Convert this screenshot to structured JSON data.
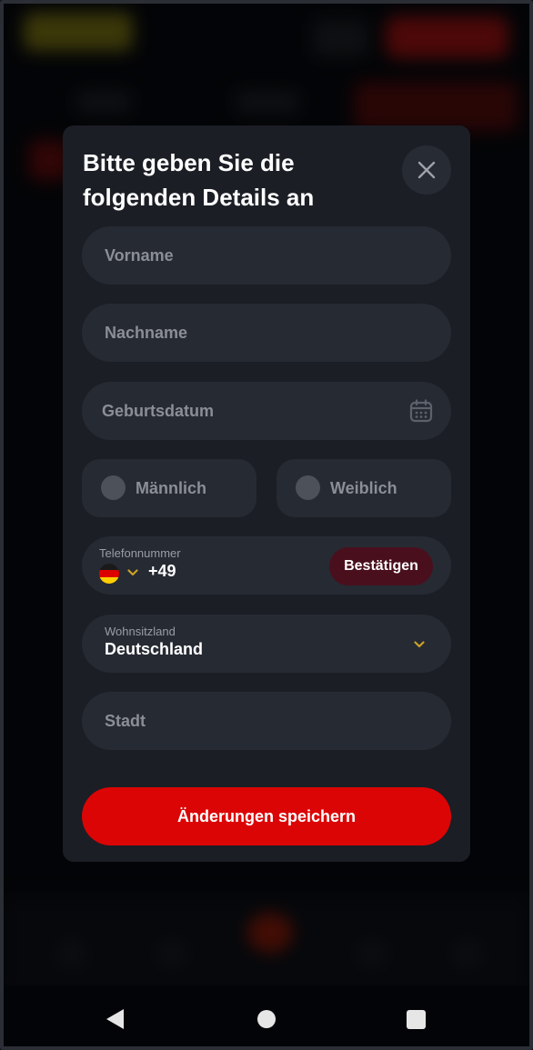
{
  "modal": {
    "title": "Bitte geben Sie die folgenden Details an",
    "first_name_placeholder": "Vorname",
    "last_name_placeholder": "Nachname",
    "birthdate_placeholder": "Geburtsdatum",
    "gender": {
      "male_label": "Männlich",
      "female_label": "Weiblich"
    },
    "phone": {
      "label": "Telefonnummer",
      "country_code": "+49",
      "confirm_label": "Bestätigen"
    },
    "residence": {
      "label": "Wohnsitzland",
      "value": "Deutschland"
    },
    "city_placeholder": "Stadt",
    "save_label": "Änderungen speichern"
  },
  "icons": {
    "close": "close-icon",
    "calendar": "calendar-icon",
    "flag": "germany-flag-icon",
    "chevron": "chevron-down-icon"
  },
  "colors": {
    "modal_bg": "#1b1e25",
    "field_bg": "#262a33",
    "primary": "#dc0505",
    "confirm_bg": "#4a0f1d",
    "chevron": "#c9a227"
  }
}
